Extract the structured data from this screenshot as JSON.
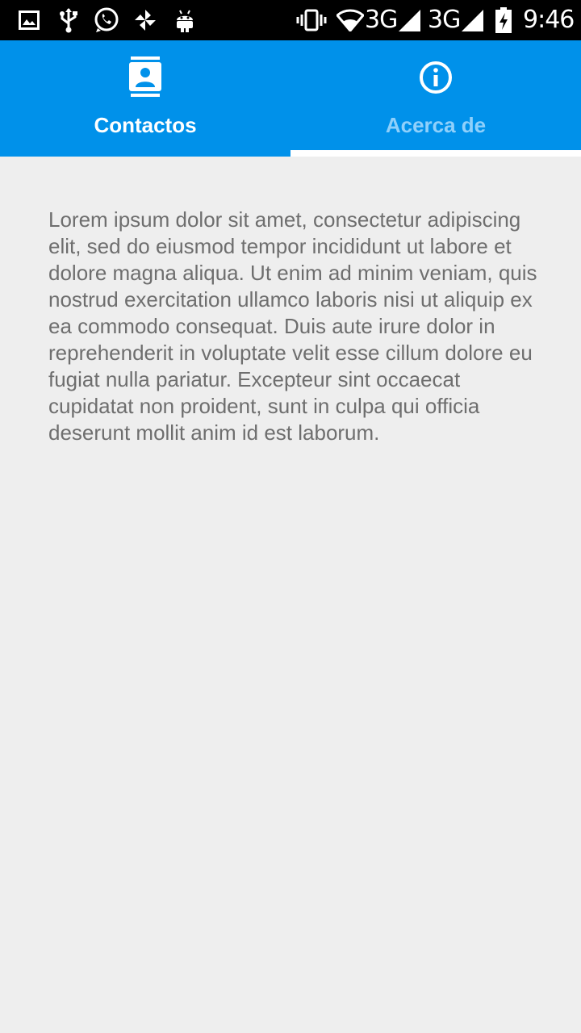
{
  "status_bar": {
    "network_1": "3G",
    "network_2": "3G",
    "time": "9:46",
    "icons": [
      "image-icon",
      "usb-icon",
      "whatsapp-icon",
      "pinwheel-icon",
      "android-icon",
      "vibrate-icon",
      "wifi-icon",
      "signal-icon",
      "signal-icon",
      "battery-charging-icon"
    ]
  },
  "tabs": [
    {
      "label": "Contactos",
      "icon": "contacts-icon",
      "selected": false
    },
    {
      "label": "Acerca de",
      "icon": "info-icon",
      "selected": true
    }
  ],
  "content": {
    "text": "Lorem ipsum dolor sit amet, consectetur adipiscing elit, sed do eiusmod tempor incididunt ut labore et dolore magna aliqua. Ut enim ad minim veniam, quis nostrud exercitation ullamco laboris nisi ut aliquip ex ea commodo consequat. Duis aute irure dolor in reprehenderit in voluptate velit esse cillum dolore eu fugiat nulla pariatur. Excepteur sint occaecat cupidatat non proident, sunt in culpa qui officia deserunt mollit anim id est laborum."
  },
  "colors": {
    "tab_bar": "#0091ea",
    "tab_selected_indicator": "#ffffff",
    "tab_label_active": "#ffffff",
    "tab_label_inactive": "#8fd0fb",
    "background": "#eeeeee",
    "body_text": "#6e6e6e"
  }
}
